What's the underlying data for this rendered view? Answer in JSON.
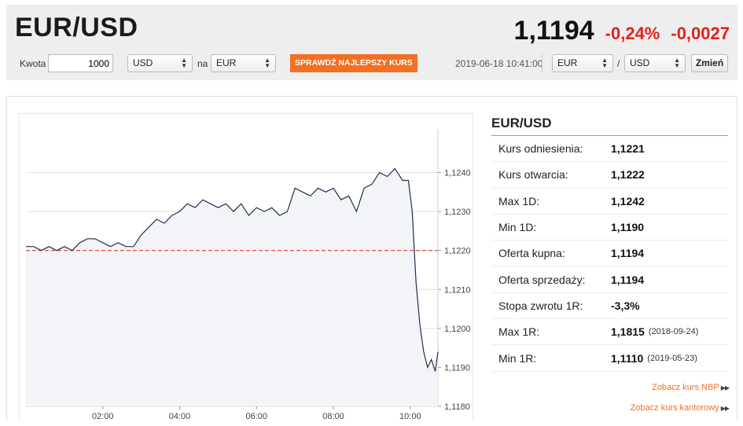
{
  "header": {
    "pair": "EUR/USD",
    "rate": "1,1194",
    "change_pct": "-0,24%",
    "change_abs": "-0,0027"
  },
  "converter": {
    "amount_label": "Kwota",
    "amount_value": "1000",
    "from_currency": "USD",
    "to_label": "na",
    "to_currency": "EUR",
    "check_button": "SPRAWDŹ NAJLEPSZY KURS",
    "datetime": "2019-06-18 10:41:00",
    "pair_base": "EUR",
    "pair_sep": "/",
    "pair_quote": "USD",
    "change_button": "Zmień"
  },
  "colors": {
    "accent_orange": "#f36f21",
    "negative_red": "#e3211b",
    "line": "#1f2f4d",
    "reference_line": "#e3211b"
  },
  "stats": {
    "title": "EUR/USD",
    "rows": [
      {
        "label": "Kurs odniesienia:",
        "value": "1,1221",
        "date": ""
      },
      {
        "label": "Kurs otwarcia:",
        "value": "1,1222",
        "date": ""
      },
      {
        "label": "Max 1D:",
        "value": "1,1242",
        "date": ""
      },
      {
        "label": "Min 1D:",
        "value": "1,1190",
        "date": ""
      },
      {
        "label": "Oferta kupna:",
        "value": "1,1194",
        "date": ""
      },
      {
        "label": "Oferta sprzedaży:",
        "value": "1,1194",
        "date": ""
      },
      {
        "label": "Stopa zwrotu 1R:",
        "value": "-3,3%",
        "date": ""
      },
      {
        "label": "Max 1R:",
        "value": "1,1815",
        "date": "(2018-09-24)"
      },
      {
        "label": "Min 1R:",
        "value": "1,1110",
        "date": "(2019-05-23)"
      }
    ],
    "link_nbp": "Zobacz kurs NBP",
    "link_kantor": "Zobacz kurs kantorowy"
  },
  "chart_data": {
    "type": "line",
    "title": "",
    "xlabel": "",
    "ylabel": "",
    "x_ticks": [
      "02:00",
      "04:00",
      "06:00",
      "08:00",
      "10:00"
    ],
    "y_ticks": [
      "1,1240",
      "1,1230",
      "1,1220",
      "1,1210",
      "1,1200",
      "1,1190",
      "1,1180"
    ],
    "ylim": [
      1.118,
      1.1251
    ],
    "xlim_hours": [
      0.0,
      10.72
    ],
    "reference_value": 1.122,
    "grid": true,
    "series": [
      {
        "x": [
          0.0,
          0.2,
          0.4,
          0.6,
          0.8,
          1.0,
          1.2,
          1.4,
          1.6,
          1.8,
          2.0,
          2.2,
          2.4,
          2.6,
          2.8,
          3.0,
          3.2,
          3.4,
          3.6,
          3.8,
          4.0,
          4.2,
          4.4,
          4.6,
          4.8,
          5.0,
          5.2,
          5.4,
          5.6,
          5.8,
          6.0,
          6.2,
          6.4,
          6.6,
          6.8,
          7.0,
          7.2,
          7.4,
          7.6,
          7.8,
          8.0,
          8.2,
          8.4,
          8.6,
          8.8,
          9.0,
          9.2,
          9.4,
          9.6,
          9.8,
          9.95,
          10.05,
          10.15,
          10.25,
          10.35,
          10.45,
          10.55,
          10.65,
          10.72
        ],
        "y": [
          1.1221,
          1.1221,
          1.122,
          1.1221,
          1.122,
          1.1221,
          1.122,
          1.1222,
          1.1223,
          1.1223,
          1.1222,
          1.1221,
          1.1222,
          1.1221,
          1.1221,
          1.1224,
          1.1226,
          1.1228,
          1.1227,
          1.1229,
          1.123,
          1.1232,
          1.1231,
          1.1233,
          1.1232,
          1.1231,
          1.1232,
          1.123,
          1.1232,
          1.1229,
          1.1231,
          1.123,
          1.1231,
          1.1229,
          1.123,
          1.1236,
          1.1235,
          1.1234,
          1.1236,
          1.1235,
          1.1236,
          1.1233,
          1.1234,
          1.123,
          1.1236,
          1.1237,
          1.124,
          1.1239,
          1.1241,
          1.1238,
          1.1238,
          1.123,
          1.1212,
          1.1201,
          1.1194,
          1.119,
          1.1192,
          1.1189,
          1.1194
        ]
      }
    ]
  }
}
